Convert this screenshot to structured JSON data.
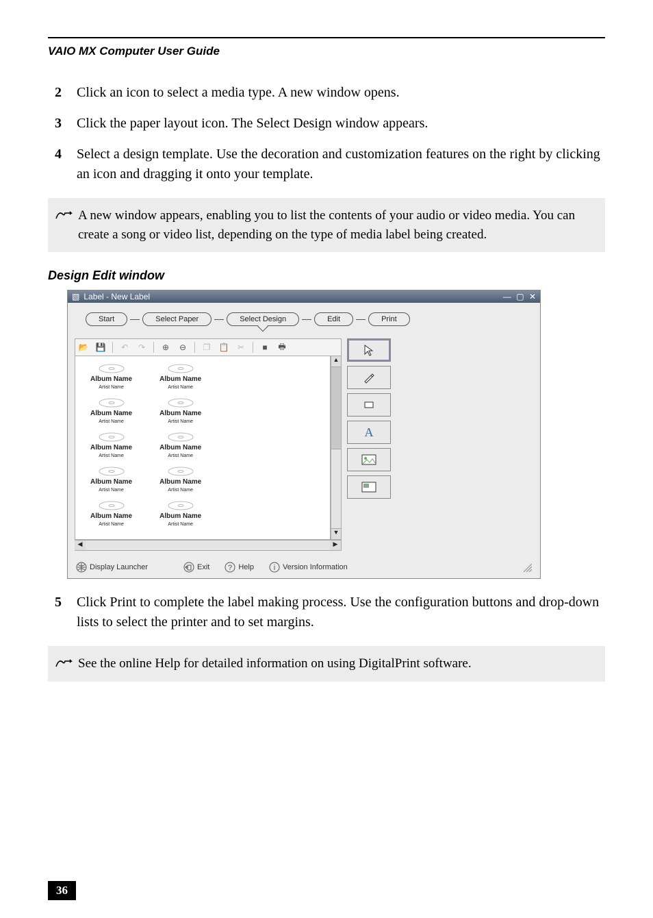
{
  "runningHead": "VAIO MX Computer User Guide",
  "steps_a": [
    {
      "n": "2",
      "txt": "Click an icon to select a media type. A new window opens."
    },
    {
      "n": "3",
      "txt": "Click the paper layout icon. The Select Design window appears."
    },
    {
      "n": "4",
      "txt": "Select a design template. Use the decoration and customization features on the right by clicking an icon and dragging it onto your template."
    }
  ],
  "note1": "A new window appears, enabling you to list the contents of your audio or video media. You can create a song or video list, depending on the type of media label being created.",
  "figCaption": "Design Edit window",
  "sc": {
    "title": "Label - New Label",
    "stepper": [
      "Start",
      "Select Paper",
      "Select Design",
      "Edit",
      "Print"
    ],
    "selStep": 2,
    "album_label": "Album Name",
    "artist_label": "Artist Name",
    "footer": {
      "launcher": "Display Launcher",
      "exit": "Exit",
      "help": "Help",
      "version": "Version Information"
    }
  },
  "steps_b": [
    {
      "n": "5",
      "txt": "Click Print to complete the label making process. Use the configuration buttons and drop-down lists to select the printer and to set margins."
    }
  ],
  "note2": "See the online Help for detailed information on using DigitalPrint software.",
  "pageNumber": "36"
}
